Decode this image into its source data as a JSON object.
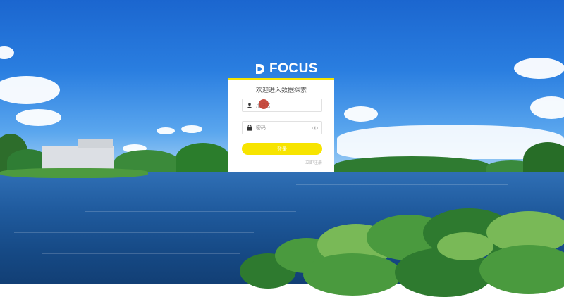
{
  "brand": {
    "name": "FOCUS"
  },
  "login": {
    "title": "欢迎进入数据探索",
    "username_placeholder": "用户名",
    "password_placeholder": "密码",
    "submit_label": "登录",
    "register_label": "立即注册"
  },
  "colors": {
    "accent": "#f7e400",
    "panel_border": "#f5e300",
    "cursor_marker": "#c0392b"
  },
  "icons": {
    "username": "user-icon",
    "password": "lock-icon",
    "visibility": "eye-icon"
  }
}
